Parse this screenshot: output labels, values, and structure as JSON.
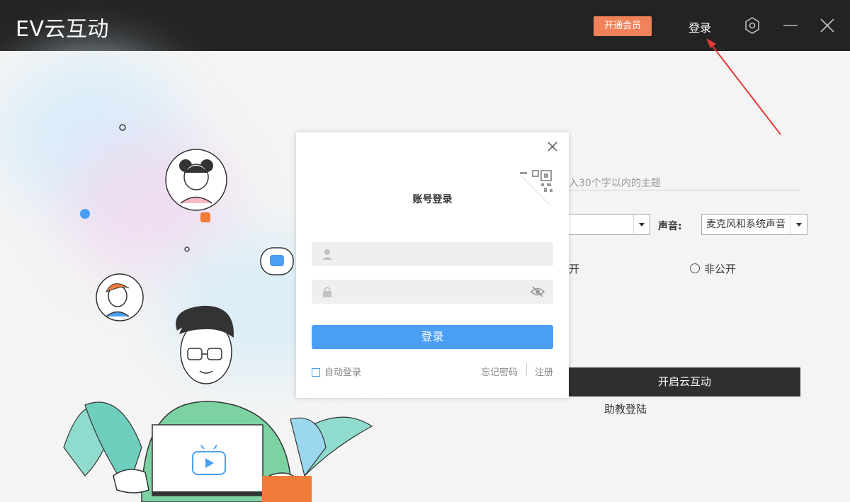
{
  "titlebar": {
    "app_title": "EV云互动",
    "vip_label": "开通会员",
    "login_label": "登录"
  },
  "form": {
    "topic_placeholder": "入30个字以内的主题",
    "sound_label": "声音:",
    "sound_value": "麦克风和系统声音",
    "public_partial": "开",
    "private_label": "非公开",
    "start_label": "开启云互动",
    "assistant_login": "助教登陆"
  },
  "modal": {
    "title": "账号登录",
    "username_placeholder": "",
    "password_placeholder": "",
    "submit_label": "登录",
    "auto_login_label": "自动登录",
    "forgot_label": "忘记密码",
    "register_label": "注册"
  },
  "colors": {
    "titlebar": "#232323",
    "vip": "#f0825a",
    "primary": "#4a9ff5",
    "start_button": "#2f2f2f",
    "annotation_arrow": "#e53935"
  },
  "icons": [
    "settings-hex-icon",
    "minimize-icon",
    "close-icon",
    "qr-code-icon",
    "user-icon",
    "lock-icon",
    "eye-off-icon",
    "play-icon"
  ]
}
